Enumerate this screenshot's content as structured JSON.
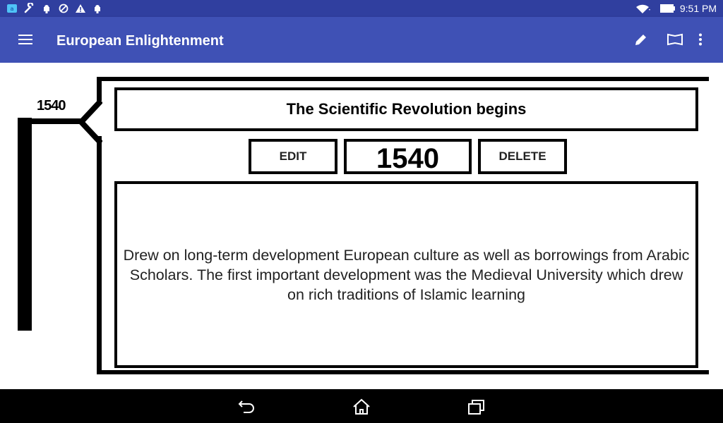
{
  "status_bar": {
    "time": "9:51 PM",
    "icons": [
      "app-notification-icon",
      "wrench-icon",
      "android-icon",
      "blocked-icon",
      "warning-icon",
      "android-icon",
      "wifi-icon",
      "battery-icon"
    ]
  },
  "app_bar": {
    "title": "European Enlightenment",
    "icons": [
      "menu-icon",
      "edit-icon",
      "book-icon",
      "overflow-menu-icon"
    ]
  },
  "timeline": {
    "marker_year": "1540"
  },
  "event": {
    "title": "The Scientific Revolution begins",
    "edit_label": "EDIT",
    "year": "1540",
    "delete_label": "DELETE",
    "description": "Drew on long-term development European culture as well as borrowings from Arabic Scholars. The first important development was the Medieval University which drew on rich traditions of Islamic learning"
  },
  "nav_bar": {
    "icons": [
      "back-icon",
      "home-icon",
      "recents-icon"
    ]
  },
  "colors": {
    "status_bar": "#303f9f",
    "app_bar": "#3f51b5",
    "nav_bar": "#000000",
    "frame": "#000000"
  }
}
